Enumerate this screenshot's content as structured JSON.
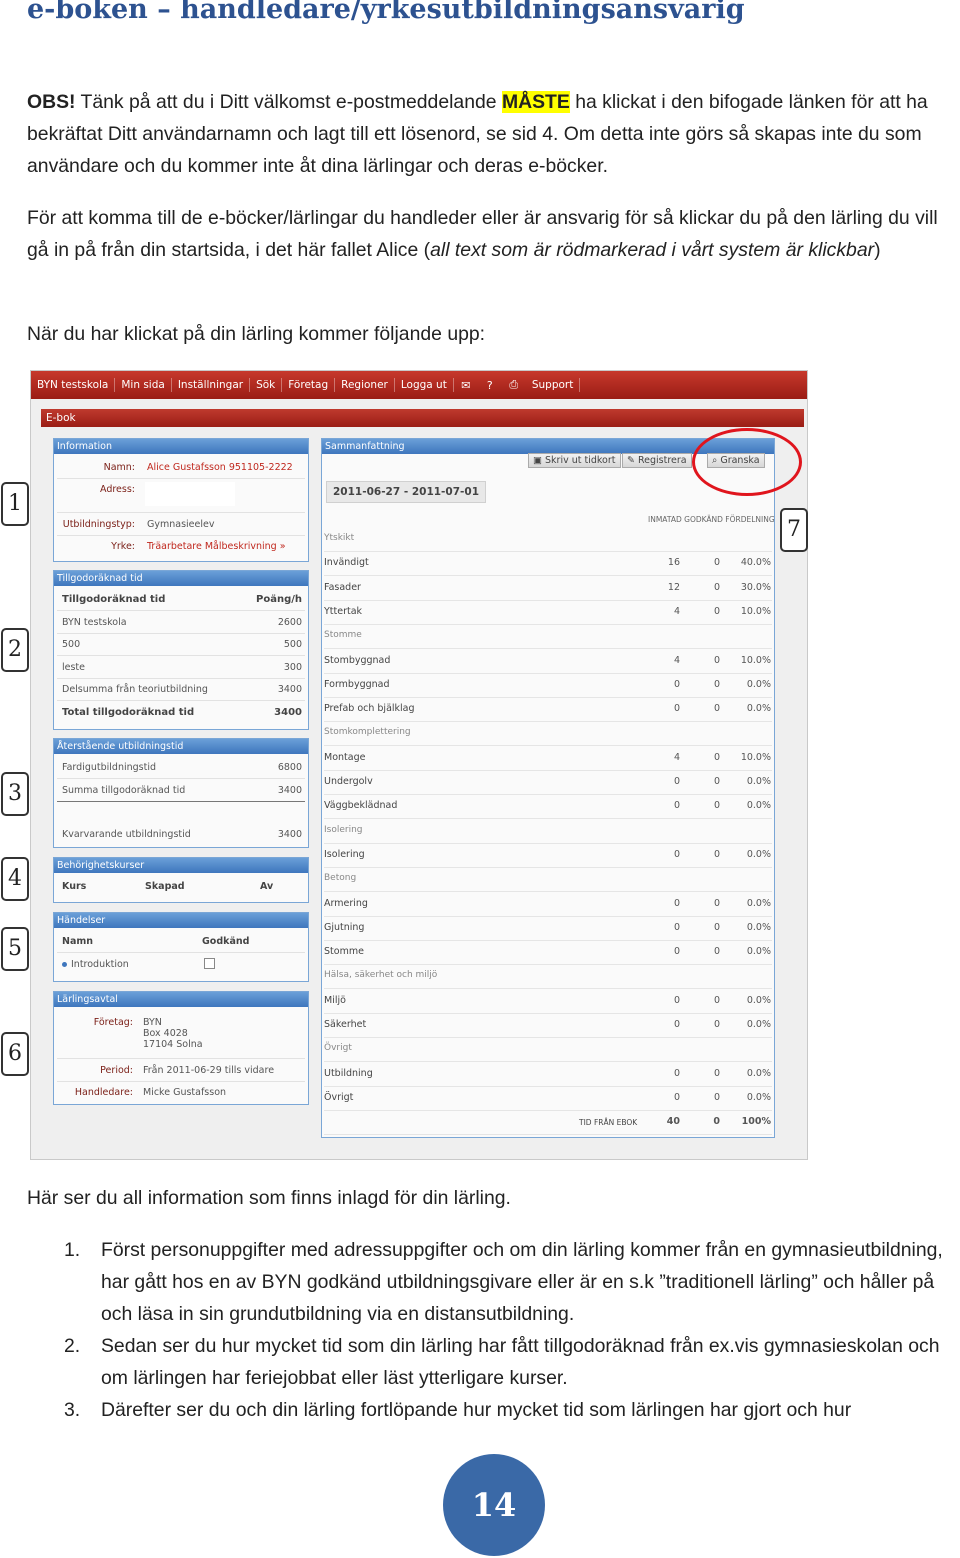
{
  "heading": "e-boken – handledare/yrkesutbildningsansvarig",
  "para1": {
    "obs": "OBS!",
    "t1": " Tänk på att du i Ditt välkomst e-postmeddelande ",
    "highlight": "MÅSTE",
    "t2": " ha klickat i den bifogade länken för att ha bekräftat Ditt användarnamn och lagt till ett lösenord, se sid 4. Om detta inte görs så skapas inte du som användare och du kommer inte åt dina lärlingar och deras e-böcker."
  },
  "para2": {
    "t1": "För att komma till de e-böcker/lärlingar du handleder eller är ansvarig för så klickar du på den lärling du vill gå in på från din startsida, i det här fallet Alice (",
    "italic": "all text som är rödmarkerad i vårt system är klickbar",
    "t2": ")"
  },
  "para3": "När du har klickat på din lärling kommer följande upp:",
  "screenshot": {
    "nav": [
      "BYN testskola",
      "Min sida",
      "Inställningar",
      "Sök",
      "Företag",
      "Regioner",
      "Logga ut"
    ],
    "nav2": [
      "Support"
    ],
    "nav_icons": [
      "mail-icon",
      "help-icon",
      "print-icon"
    ],
    "ebok": "E-bok",
    "info": {
      "title": "Information",
      "rows": [
        {
          "label": "Namn:",
          "value": "Alice Gustafsson 951105-2222"
        },
        {
          "label": "Adress:",
          "value": ""
        },
        {
          "label": "Utbildningstyp:",
          "value": "Gymnasieelev"
        },
        {
          "label": "Yrke:",
          "value": "Träarbetare Målbeskrivning »"
        }
      ]
    },
    "tillgodo": {
      "title": "Tillgodoräknad tid",
      "header": [
        "Tillgodoräknad tid",
        "Poäng/h"
      ],
      "rows": [
        [
          "BYN testskola",
          "2600"
        ],
        [
          "500",
          "500"
        ],
        [
          "leste",
          "300"
        ],
        [
          "Delsumma från teoriutbildning",
          "3400"
        ]
      ],
      "total": [
        "Total tillgodoräknad tid",
        "3400"
      ]
    },
    "aterstaende": {
      "title": "Återstående utbildningstid",
      "rows": [
        [
          "Fardigutbildningstid",
          "6800"
        ],
        [
          "Summa tillgodoräknad tid",
          "3400"
        ],
        [
          "Kvarvarande utbildningstid",
          "3400"
        ]
      ]
    },
    "behorighet": {
      "title": "Behörighetskurser",
      "cols": [
        "Kurs",
        "Skapad",
        "Av"
      ]
    },
    "handelser": {
      "title": "Händelser",
      "cols": [
        "Namn",
        "Godkänd"
      ],
      "item": "Introduktion"
    },
    "larlingsavtal": {
      "title": "Lärlingsavtal",
      "foretag_label": "Företag:",
      "foretag": [
        "BYN",
        "Box 4028",
        "17104 Solna"
      ],
      "period_label": "Period:",
      "period": "Från 2011-06-29 tills vidare",
      "handledare_label": "Handledare:",
      "handledare": "Micke Gustafsson"
    },
    "sammanfattning": {
      "title": "Sammanfattning",
      "buttons": [
        "Skriv ut tidkort",
        "Registrera",
        "Granska"
      ],
      "date_range": "2011-06-27 - 2011-07-01",
      "col_headers": "INMATAD GODKÄND FÖRDELNING",
      "rows": [
        {
          "n": "Ytskikt",
          "cat": true
        },
        {
          "n": "Invändigt",
          "a": "16",
          "b": "0",
          "c": "40.0%"
        },
        {
          "n": "Fasader",
          "a": "12",
          "b": "0",
          "c": "30.0%"
        },
        {
          "n": "Yttertak",
          "a": "4",
          "b": "0",
          "c": "10.0%"
        },
        {
          "n": "Stomme",
          "cat": true
        },
        {
          "n": "Stombyggnad",
          "a": "4",
          "b": "0",
          "c": "10.0%"
        },
        {
          "n": "Formbyggnad",
          "a": "0",
          "b": "0",
          "c": "0.0%"
        },
        {
          "n": "Prefab och bjälklag",
          "a": "0",
          "b": "0",
          "c": "0.0%"
        },
        {
          "n": "Stomkomplettering",
          "cat": true
        },
        {
          "n": "Montage",
          "a": "4",
          "b": "0",
          "c": "10.0%"
        },
        {
          "n": "Undergolv",
          "a": "0",
          "b": "0",
          "c": "0.0%"
        },
        {
          "n": "Väggbeklädnad",
          "a": "0",
          "b": "0",
          "c": "0.0%"
        },
        {
          "n": "Isolering",
          "cat": true
        },
        {
          "n": "Isolering",
          "a": "0",
          "b": "0",
          "c": "0.0%"
        },
        {
          "n": "Betong",
          "cat": true
        },
        {
          "n": "Armering",
          "a": "0",
          "b": "0",
          "c": "0.0%"
        },
        {
          "n": "Gjutning",
          "a": "0",
          "b": "0",
          "c": "0.0%"
        },
        {
          "n": "Stomme",
          "a": "0",
          "b": "0",
          "c": "0.0%"
        },
        {
          "n": "Hälsa, säkerhet och miljö",
          "cat": true
        },
        {
          "n": "Miljö",
          "a": "0",
          "b": "0",
          "c": "0.0%"
        },
        {
          "n": "Säkerhet",
          "a": "0",
          "b": "0",
          "c": "0.0%"
        },
        {
          "n": "Övrigt",
          "cat": true
        },
        {
          "n": "Utbildning",
          "a": "0",
          "b": "0",
          "c": "0.0%"
        },
        {
          "n": "Övrigt",
          "a": "0",
          "b": "0",
          "c": "0.0%"
        },
        {
          "n": "TID FRÅN EBOK",
          "a": "40",
          "b": "0",
          "c": "100%",
          "total": true
        }
      ]
    }
  },
  "callouts": [
    "1",
    "2",
    "3",
    "4",
    "5",
    "6",
    "7"
  ],
  "para4": "Här ser du all information som finns inlagd för din lärling.",
  "list": [
    {
      "num": "1.",
      "text": "Först personuppgifter med adressuppgifter och om din lärling kommer från en gymnasieutbildning, har gått hos en av BYN godkänd utbildningsgivare eller är en s.k ”traditionell lärling” och håller på och läsa in sin grundutbildning via en distansutbildning."
    },
    {
      "num": "2.",
      "text": "Sedan ser du hur mycket tid som din lärling har fått tillgodoräknad från ex.vis gymnasieskolan och om lärlingen har feriejobbat eller läst ytterligare kurser."
    },
    {
      "num": "3.",
      "text": "Därefter ser du och din lärling fortlöpande hur mycket tid som lärlingen har gjort och hur"
    }
  ],
  "page_number": "14",
  "colors": {
    "heading": "#2d5290",
    "nav": "#b02a20",
    "panel_header": "#4a83c6",
    "highlight": "#ffff00",
    "oval": "#e0151d",
    "page_circle": "#3a69a7"
  }
}
